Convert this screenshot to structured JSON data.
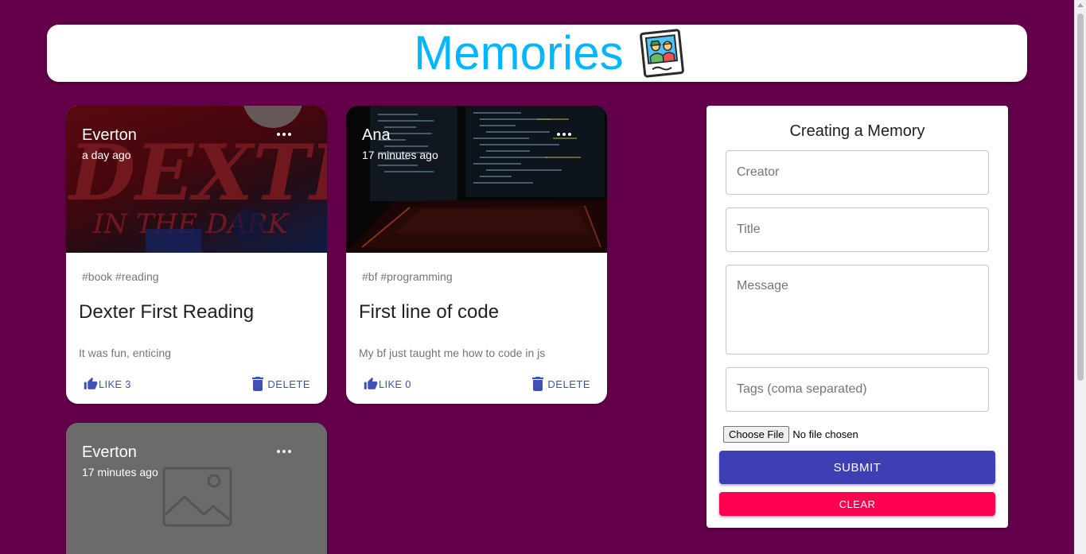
{
  "app": {
    "title": "Memories",
    "title_color": "#00b7ff",
    "background": "#64004b",
    "logo_icon": "photo-polaroid-icon"
  },
  "posts": [
    {
      "creator": "Everton",
      "time": "a day ago",
      "image": "dexter-book-cover",
      "image_text": "DEXTER",
      "image_subtext": "IN THE DARK",
      "tags": "#book #reading",
      "title": "Dexter First Reading",
      "message": "It was fun, enticing",
      "like_label": "LIKE 3",
      "delete_label": "DELETE"
    },
    {
      "creator": "Ana",
      "time": "17 minutes ago",
      "image": "code-monitor-keyboard",
      "tags": "#bf #programming",
      "title": "First line of code",
      "message": "My bf just taught me how to code in js",
      "like_label": "LIKE 0",
      "delete_label": "DELETE"
    },
    {
      "creator": "Everton",
      "time": "17 minutes ago",
      "image": "image-placeholder-icon"
    }
  ],
  "form": {
    "heading": "Creating a Memory",
    "creator_placeholder": "Creator",
    "title_placeholder": "Title",
    "message_placeholder": "Message",
    "tags_placeholder": "Tags (coma separated)",
    "file_button": "Choose File",
    "file_status": "No file chosen",
    "submit_label": "SUBMIT",
    "clear_label": "CLEAR",
    "submit_color": "#3f3fb5",
    "clear_color": "#ff0050"
  }
}
